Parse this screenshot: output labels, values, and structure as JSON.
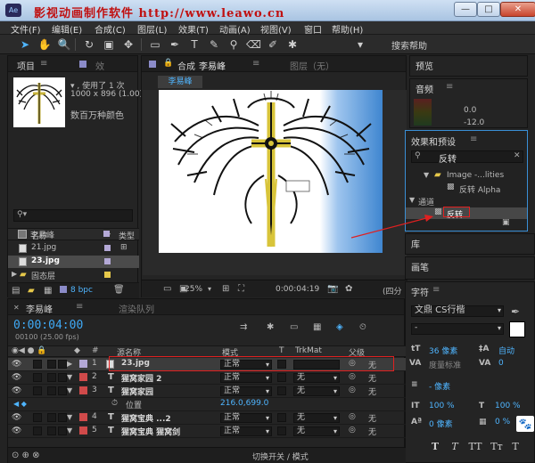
{
  "window": {
    "title": "影视动画制作软件   http://www.leawo.cn",
    "btn_min": "—",
    "btn_max": "□",
    "btn_close": "✕"
  },
  "menu": [
    "文件(F)",
    "编辑(E)",
    "合成(C)",
    "图层(L)",
    "效果(T)",
    "动画(A)",
    "视图(V)",
    "窗口",
    "帮助(H)"
  ],
  "toolbar": {
    "search_help": "搜索帮助"
  },
  "project": {
    "tab_project": "项目",
    "tab_effects": "效",
    "info_used": "▾ , 使用了 1 次",
    "info_size": "1000 x 896 (1.00)",
    "info_colors": "数百万种颜色",
    "col_name": "名称",
    "col_type": "类型",
    "items": [
      {
        "name": "21.jpg",
        "color": "#b3a8d6"
      },
      {
        "name": "23.jpg",
        "color": "#b3a8d6"
      },
      {
        "name": "固态层",
        "color": "#e6c84a"
      },
      {
        "name": "李易峰",
        "color": "#b3a8d6"
      }
    ],
    "bpc": "8 bpc"
  },
  "comp": {
    "lock_icon": "🔒",
    "tab_label": "合成",
    "tab_name": "李易峰",
    "layer_tab": "图层（无）",
    "comp_tab_label": "李易峰",
    "zoom": "25%",
    "time": "0:00:04:19",
    "quality": "(四分"
  },
  "preview": {
    "title": "预览",
    "audio": "音频",
    "val1": "0.0",
    "val2": "-12.0"
  },
  "effects": {
    "title": "效果和预设",
    "search": "反转",
    "tree": [
      {
        "text": "Image -...lities",
        "indent": 2,
        "folder": true
      },
      {
        "text": "反转 Alpha",
        "indent": 3,
        "folder": false
      },
      {
        "text": "通道",
        "indent": 0,
        "folder": true
      },
      {
        "text": "反转",
        "indent": 2,
        "folder": false
      }
    ]
  },
  "library": {
    "title": "库"
  },
  "brush": {
    "title": "画笔"
  },
  "character": {
    "title": "字符",
    "font": "文鼎 CS行楷",
    "style": "-",
    "size": "36 像素",
    "leading": "自动",
    "tracking_label": "度量标准",
    "tracking": "0",
    "indent": "- 像素",
    "scale_v": "100 %",
    "scale_h": "100 %",
    "baseline": "0 像素",
    "tsume": "0 %",
    "t_buttons": [
      "T",
      "T",
      "TT",
      "Tт",
      "T"
    ]
  },
  "timeline": {
    "tab": "李易峰",
    "tab_render": "渲染队列",
    "timecode": "0:00:04:00",
    "fps": "00100 (25.00 fps)",
    "col_source": "源名称",
    "col_mode": "模式",
    "col_t": "T",
    "col_trkmat": "TrkMat",
    "col_parent": "父级",
    "layers": [
      {
        "num": "1",
        "name": "23.jpg",
        "label": "#b3a8d6",
        "mode": "正常",
        "trk": "",
        "parent": "无",
        "sel": true,
        "icon": true
      },
      {
        "num": "2",
        "name": "猩窝家园 2",
        "label": "#d04a4a",
        "mode": "正常",
        "trk": "无",
        "parent": "无",
        "sel": false,
        "icon": false
      },
      {
        "num": "3",
        "name": "猩窝家园",
        "label": "#d04a4a",
        "mode": "正常",
        "trk": "无",
        "parent": "无",
        "sel": false,
        "icon": false
      },
      {
        "num": "4",
        "name": "猩窝宝典    ...2",
        "label": "#d04a4a",
        "mode": "正常",
        "trk": "无",
        "parent": "无",
        "sel": false,
        "icon": false
      },
      {
        "num": "5",
        "name": "猩窝宝典    猩窝剑",
        "label": "#d04a4a",
        "mode": "正常",
        "trk": "无",
        "parent": "无",
        "sel": false,
        "icon": false
      }
    ],
    "position_label": "位置",
    "position_value": "216.0,699.0",
    "footer": "切换开关 / 模式"
  },
  "colors": {
    "accent": "#3fa9f5",
    "annotation": "#e02020"
  }
}
